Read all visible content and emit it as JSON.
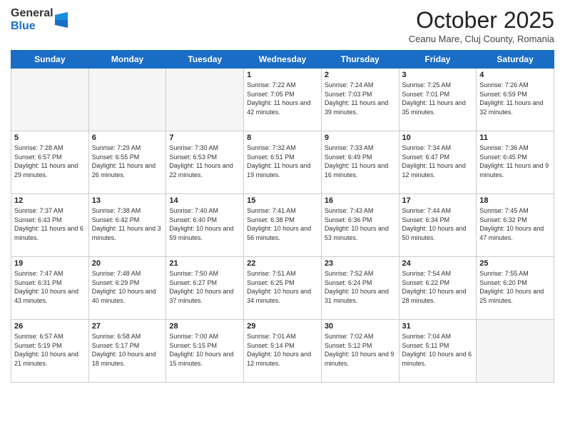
{
  "logo": {
    "general": "General",
    "blue": "Blue"
  },
  "title": "October 2025",
  "subtitle": "Ceanu Mare, Cluj County, Romania",
  "days_of_week": [
    "Sunday",
    "Monday",
    "Tuesday",
    "Wednesday",
    "Thursday",
    "Friday",
    "Saturday"
  ],
  "weeks": [
    [
      {
        "day": "",
        "empty": true
      },
      {
        "day": "",
        "empty": true
      },
      {
        "day": "",
        "empty": true
      },
      {
        "day": "1",
        "sunrise": "7:22 AM",
        "sunset": "7:05 PM",
        "daylight": "11 hours and 42 minutes."
      },
      {
        "day": "2",
        "sunrise": "7:24 AM",
        "sunset": "7:03 PM",
        "daylight": "11 hours and 39 minutes."
      },
      {
        "day": "3",
        "sunrise": "7:25 AM",
        "sunset": "7:01 PM",
        "daylight": "11 hours and 35 minutes."
      },
      {
        "day": "4",
        "sunrise": "7:26 AM",
        "sunset": "6:59 PM",
        "daylight": "11 hours and 32 minutes."
      }
    ],
    [
      {
        "day": "5",
        "sunrise": "7:28 AM",
        "sunset": "6:57 PM",
        "daylight": "11 hours and 29 minutes."
      },
      {
        "day": "6",
        "sunrise": "7:29 AM",
        "sunset": "6:55 PM",
        "daylight": "11 hours and 26 minutes."
      },
      {
        "day": "7",
        "sunrise": "7:30 AM",
        "sunset": "6:53 PM",
        "daylight": "11 hours and 22 minutes."
      },
      {
        "day": "8",
        "sunrise": "7:32 AM",
        "sunset": "6:51 PM",
        "daylight": "11 hours and 19 minutes."
      },
      {
        "day": "9",
        "sunrise": "7:33 AM",
        "sunset": "6:49 PM",
        "daylight": "11 hours and 16 minutes."
      },
      {
        "day": "10",
        "sunrise": "7:34 AM",
        "sunset": "6:47 PM",
        "daylight": "11 hours and 12 minutes."
      },
      {
        "day": "11",
        "sunrise": "7:36 AM",
        "sunset": "6:45 PM",
        "daylight": "11 hours and 9 minutes."
      }
    ],
    [
      {
        "day": "12",
        "sunrise": "7:37 AM",
        "sunset": "6:43 PM",
        "daylight": "11 hours and 6 minutes."
      },
      {
        "day": "13",
        "sunrise": "7:38 AM",
        "sunset": "6:42 PM",
        "daylight": "11 hours and 3 minutes."
      },
      {
        "day": "14",
        "sunrise": "7:40 AM",
        "sunset": "6:40 PM",
        "daylight": "10 hours and 59 minutes."
      },
      {
        "day": "15",
        "sunrise": "7:41 AM",
        "sunset": "6:38 PM",
        "daylight": "10 hours and 56 minutes."
      },
      {
        "day": "16",
        "sunrise": "7:43 AM",
        "sunset": "6:36 PM",
        "daylight": "10 hours and 53 minutes."
      },
      {
        "day": "17",
        "sunrise": "7:44 AM",
        "sunset": "6:34 PM",
        "daylight": "10 hours and 50 minutes."
      },
      {
        "day": "18",
        "sunrise": "7:45 AM",
        "sunset": "6:32 PM",
        "daylight": "10 hours and 47 minutes."
      }
    ],
    [
      {
        "day": "19",
        "sunrise": "7:47 AM",
        "sunset": "6:31 PM",
        "daylight": "10 hours and 43 minutes."
      },
      {
        "day": "20",
        "sunrise": "7:48 AM",
        "sunset": "6:29 PM",
        "daylight": "10 hours and 40 minutes."
      },
      {
        "day": "21",
        "sunrise": "7:50 AM",
        "sunset": "6:27 PM",
        "daylight": "10 hours and 37 minutes."
      },
      {
        "day": "22",
        "sunrise": "7:51 AM",
        "sunset": "6:25 PM",
        "daylight": "10 hours and 34 minutes."
      },
      {
        "day": "23",
        "sunrise": "7:52 AM",
        "sunset": "6:24 PM",
        "daylight": "10 hours and 31 minutes."
      },
      {
        "day": "24",
        "sunrise": "7:54 AM",
        "sunset": "6:22 PM",
        "daylight": "10 hours and 28 minutes."
      },
      {
        "day": "25",
        "sunrise": "7:55 AM",
        "sunset": "6:20 PM",
        "daylight": "10 hours and 25 minutes."
      }
    ],
    [
      {
        "day": "26",
        "sunrise": "6:57 AM",
        "sunset": "5:19 PM",
        "daylight": "10 hours and 21 minutes."
      },
      {
        "day": "27",
        "sunrise": "6:58 AM",
        "sunset": "5:17 PM",
        "daylight": "10 hours and 18 minutes."
      },
      {
        "day": "28",
        "sunrise": "7:00 AM",
        "sunset": "5:15 PM",
        "daylight": "10 hours and 15 minutes."
      },
      {
        "day": "29",
        "sunrise": "7:01 AM",
        "sunset": "5:14 PM",
        "daylight": "10 hours and 12 minutes."
      },
      {
        "day": "30",
        "sunrise": "7:02 AM",
        "sunset": "5:12 PM",
        "daylight": "10 hours and 9 minutes."
      },
      {
        "day": "31",
        "sunrise": "7:04 AM",
        "sunset": "5:11 PM",
        "daylight": "10 hours and 6 minutes."
      },
      {
        "day": "",
        "empty": true
      }
    ]
  ]
}
